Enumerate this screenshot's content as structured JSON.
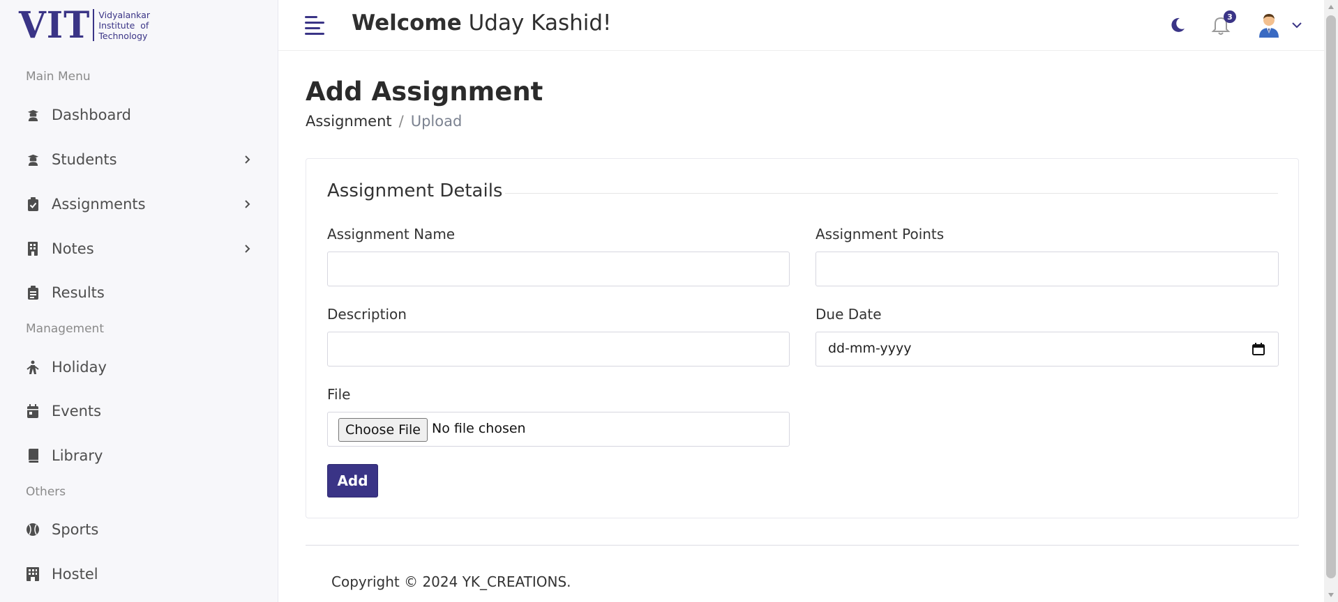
{
  "logo": {
    "mark": "VIT",
    "lines": [
      "Vidyalankar",
      "Institute  of",
      "Technology"
    ]
  },
  "sidebar": {
    "sections": [
      "Main Menu",
      "Management",
      "Others"
    ],
    "items": [
      {
        "label": "Dashboard",
        "icon": "graduate-icon"
      },
      {
        "label": "Students",
        "icon": "graduate-icon"
      },
      {
        "label": "Assignments",
        "icon": "clipboard-check-icon"
      },
      {
        "label": "Notes",
        "icon": "building-icon"
      },
      {
        "label": "Results",
        "icon": "clipboard-list-icon"
      },
      {
        "label": "Holiday",
        "icon": "holiday-icon"
      },
      {
        "label": "Events",
        "icon": "calendar-icon"
      },
      {
        "label": "Library",
        "icon": "book-icon"
      },
      {
        "label": "Sports",
        "icon": "baseball-icon"
      },
      {
        "label": "Hostel",
        "icon": "hotel-icon"
      }
    ]
  },
  "header": {
    "welcome_bold": "Welcome",
    "welcome_name": " Uday Kashid!",
    "notification_count": "3"
  },
  "page": {
    "title": "Add Assignment",
    "breadcrumb": [
      "Assignment",
      "/",
      "Upload"
    ]
  },
  "form": {
    "legend": "Assignment Details",
    "assignment_name_label": "Assignment Name",
    "assignment_name_value": "",
    "assignment_points_label": "Assignment Points",
    "assignment_points_value": "",
    "description_label": "Description",
    "description_value": "",
    "due_date_label": "Due Date",
    "due_date_placeholder": "dd-mm-yyyy",
    "file_label": "File",
    "file_button": "Choose File",
    "file_status": "No file chosen",
    "submit_label": "Add"
  },
  "footer": {
    "copyright": "Copyright © 2024 YK_CREATIONS."
  },
  "colors": {
    "primary": "#3a3486",
    "sidebar_bg": "#f7f7fa",
    "text_muted": "#8a8a8a"
  }
}
